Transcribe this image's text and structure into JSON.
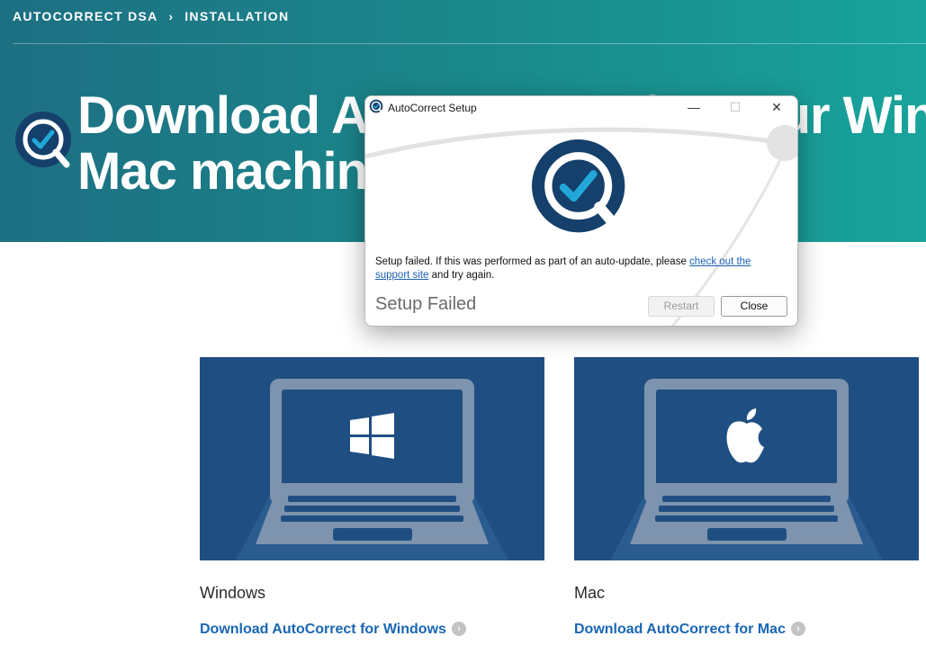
{
  "breadcrumb": {
    "root": "AUTOCORRECT DSA",
    "separator": "›",
    "current": "INSTALLATION"
  },
  "hero": {
    "title_line1": "Download AutoCorrect for your Windows or",
    "title_line2": "Mac machine",
    "logo_icon": "autocorrect-logo-icon"
  },
  "dialog": {
    "title": "AutoCorrect Setup",
    "minimize": "—",
    "maximize": "☐",
    "close": "✕",
    "message_prefix": "Setup failed. If this was performed as part of an auto-update, please ",
    "message_link": "check out the support site",
    "message_suffix": " and try again.",
    "status": "Setup Failed",
    "restart_label": "Restart",
    "close_label": "Close"
  },
  "cards": [
    {
      "title": "Windows",
      "link": "Download AutoCorrect for Windows",
      "os_icon": "windows-logo-icon"
    },
    {
      "title": "Mac",
      "link": "Download AutoCorrect for Mac",
      "os_icon": "apple-logo-icon"
    }
  ],
  "link_arrow": "›",
  "colors": {
    "hero_start": "#1d6f82",
    "hero_end": "#18a39c",
    "card_bg": "#1f4f82",
    "link": "#1966b3",
    "logo_navy": "#14406b",
    "logo_cyan": "#21a8d8"
  }
}
